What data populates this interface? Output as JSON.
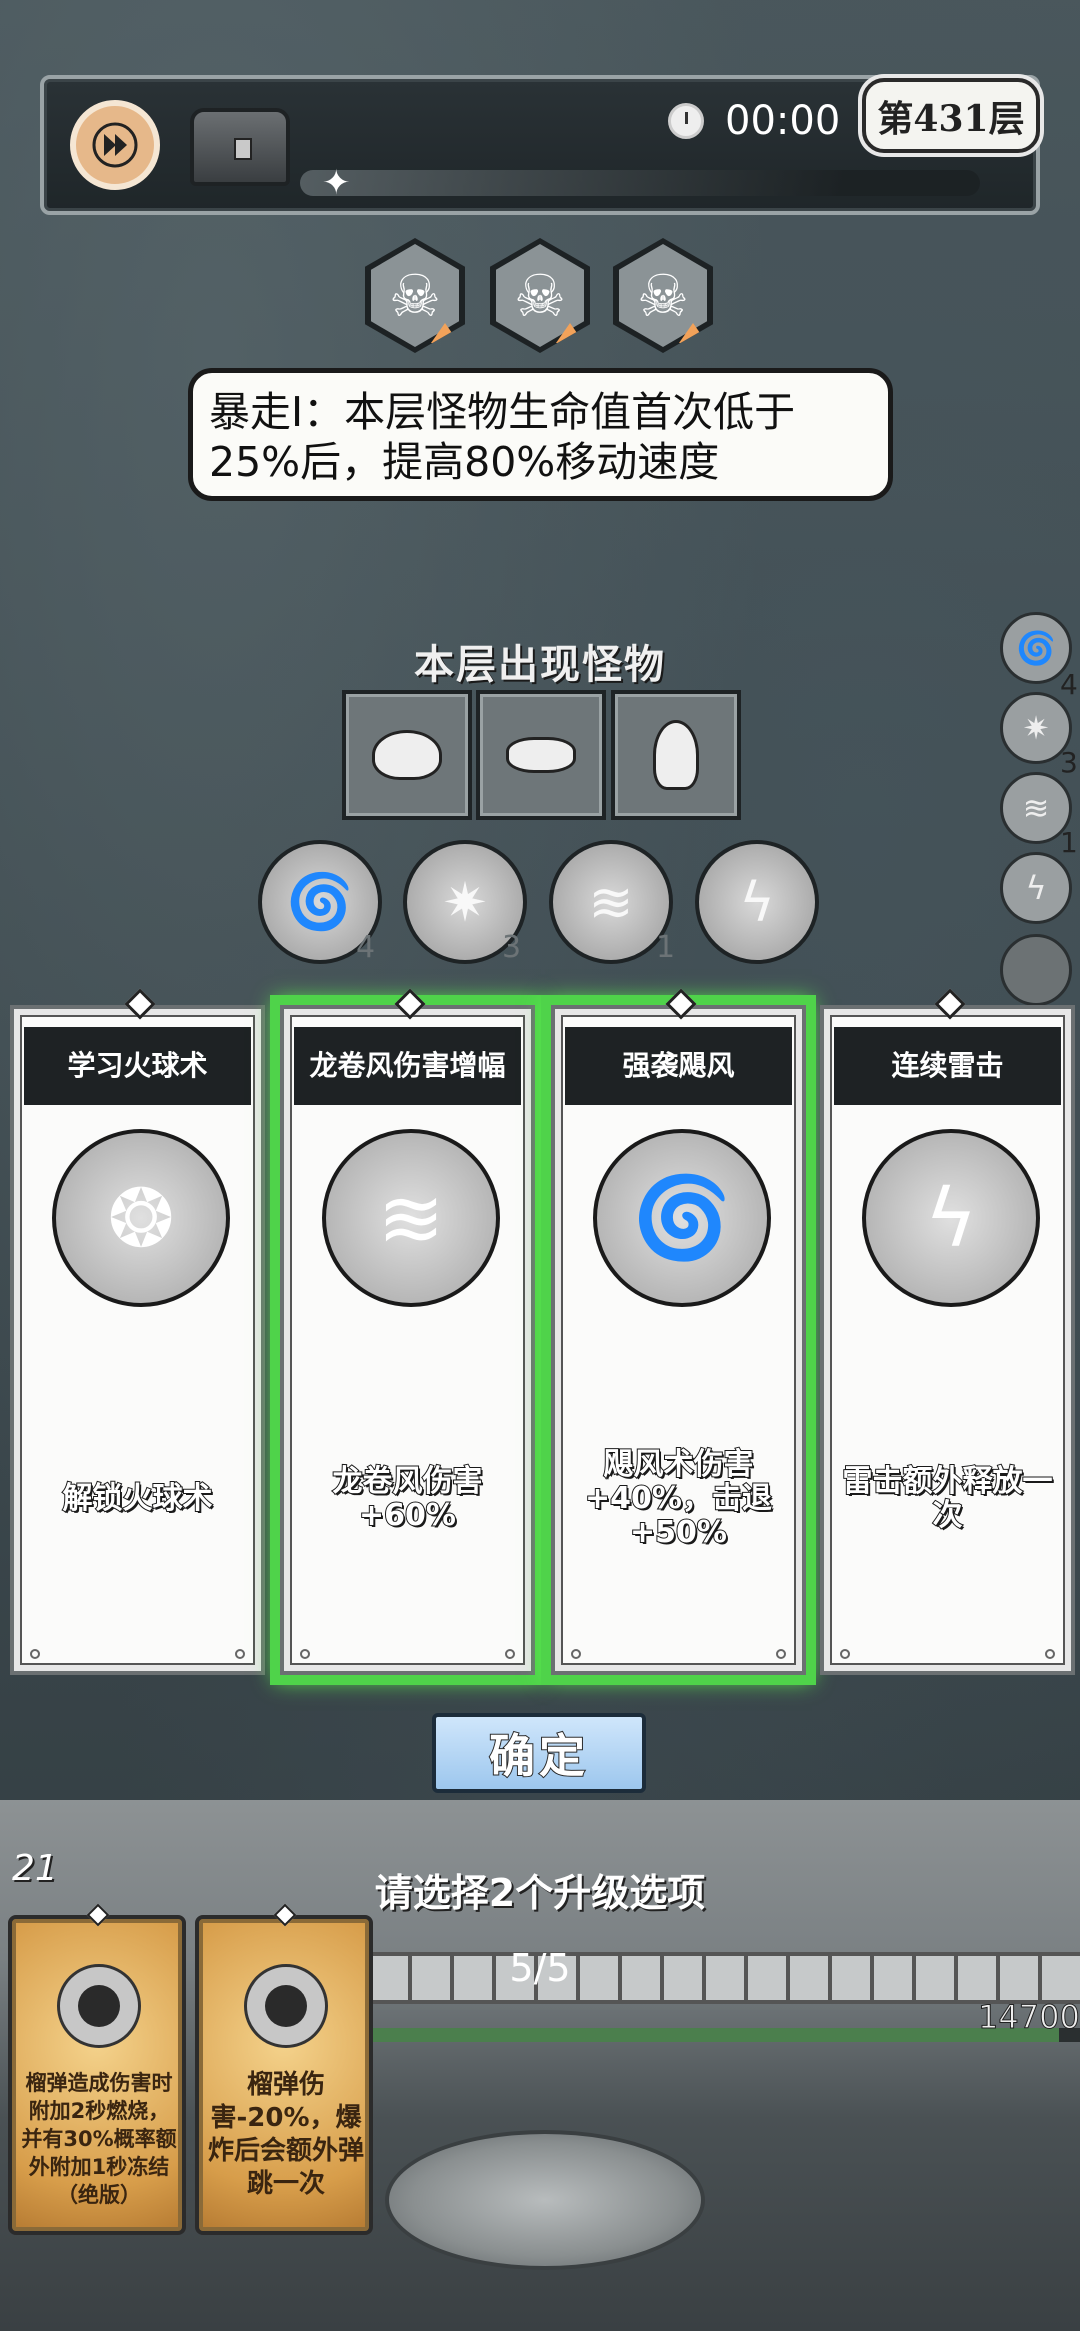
{
  "header": {
    "timer": "00:00",
    "floor": "第431层"
  },
  "modifiers": {
    "description": "暴走Ⅰ：本层怪物生命值首次低于25%后，提高80%移动速度",
    "icons": [
      "skull-rage-icon",
      "skull-red-eyes-icon",
      "skull-speed-icon"
    ]
  },
  "monsters": {
    "title": "本层出现怪物",
    "items": [
      "rabbit-monster",
      "slime-monster",
      "ghost-monster"
    ]
  },
  "owned_skills": [
    {
      "icon": "tornado-icon",
      "level": "4"
    },
    {
      "icon": "crystal-icon",
      "level": "3"
    },
    {
      "icon": "whirlwind-icon",
      "level": "1"
    },
    {
      "icon": "lightning-icon",
      "level": ""
    }
  ],
  "side_skills": [
    {
      "icon": "tornado-icon",
      "level": "4"
    },
    {
      "icon": "crystal-icon",
      "level": "3"
    },
    {
      "icon": "whirlwind-icon",
      "level": "1"
    },
    {
      "icon": "lightning-icon",
      "level": ""
    },
    {
      "icon": "empty-slot",
      "level": ""
    }
  ],
  "cards": [
    {
      "title": "学习火球术",
      "desc": "解锁火球术",
      "icon": "fireball-icon",
      "selected": false
    },
    {
      "title": "龙卷风伤害增幅",
      "desc": "龙卷风伤害+60%",
      "icon": "whirlwind-icon",
      "selected": true
    },
    {
      "title": "强袭飓风",
      "desc": "飓风术伤害+40%，击退+50%",
      "icon": "tornado-icon",
      "selected": true
    },
    {
      "title": "连续雷击",
      "desc": "雷击额外释放一次",
      "icon": "lightning-icon",
      "selected": false
    }
  ],
  "confirm_label": "确定",
  "bottom": {
    "level": "21",
    "instruction": "请选择2个升级选项",
    "wave": "5/5",
    "hp": "14700",
    "hp_fraction": 0.97
  },
  "equipped_cards": [
    {
      "desc": "榴弹造成伤害时附加2秒燃烧，并有30%概率额外附加1秒冻结（绝版）",
      "icon": "grenade-icon"
    },
    {
      "desc": "榴弹伤害-20%，爆炸后会额外弹跳一次",
      "icon": "grenade-icon"
    }
  ]
}
